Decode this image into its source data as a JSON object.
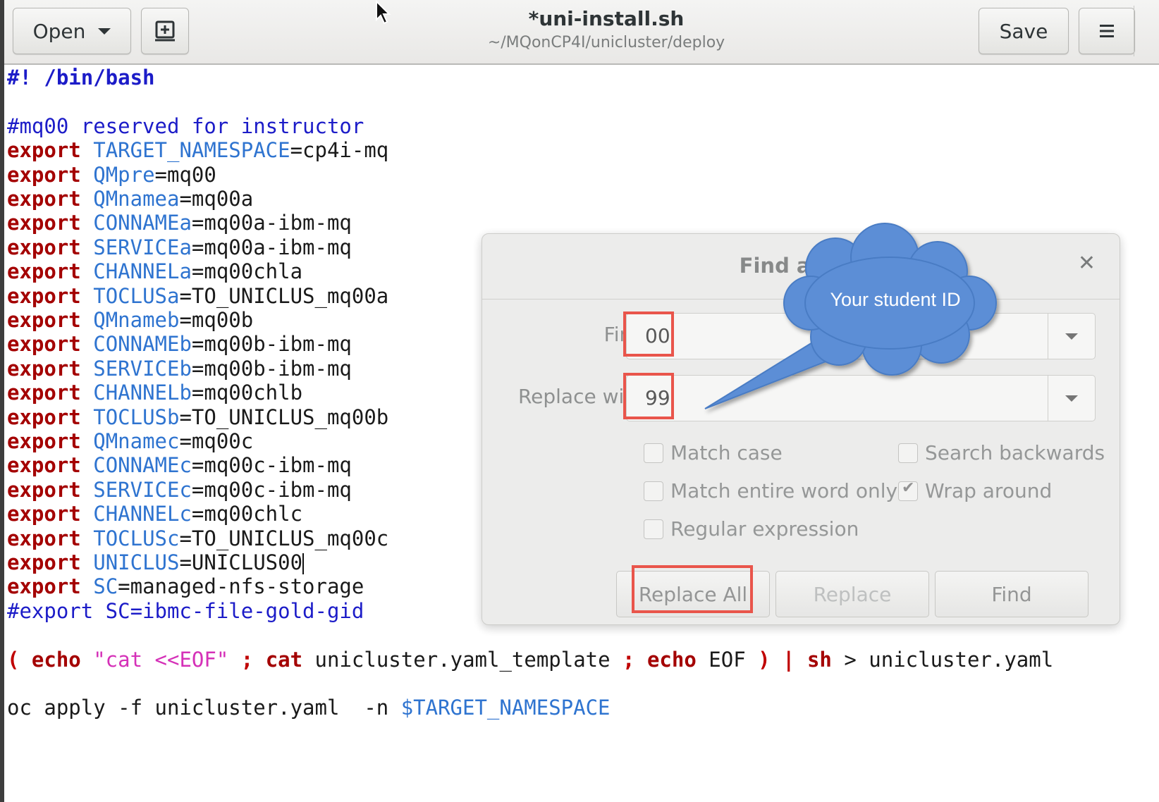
{
  "header": {
    "open_label": "Open",
    "new_doc_icon": "new-document-icon",
    "title": "*uni-install.sh",
    "path": "~/MQonCP4I/unicluster/deploy",
    "save_label": "Save",
    "menu_icon": "hamburger-menu-icon"
  },
  "editor": {
    "lines": [
      {
        "a": "#! /bin/bash"
      },
      {
        "a": ""
      },
      {
        "a": "#mq00 reserved for instructor"
      },
      {
        "kw": "export",
        "var": "TARGET_NAMESPACE",
        "val": "=cp4i-mq"
      },
      {
        "kw": "export",
        "var": "QMpre",
        "val": "=mq00"
      },
      {
        "kw": "export",
        "var": "QMnamea",
        "val": "=mq00a"
      },
      {
        "kw": "export",
        "var": "CONNAMEa",
        "val": "=mq00a-ibm-mq"
      },
      {
        "kw": "export",
        "var": "SERVICEa",
        "val": "=mq00a-ibm-mq"
      },
      {
        "kw": "export",
        "var": "CHANNELa",
        "val": "=mq00chla"
      },
      {
        "kw": "export",
        "var": "TOCLUSa",
        "val": "=TO_UNICLUS_mq00a"
      },
      {
        "kw": "export",
        "var": "QMnameb",
        "val": "=mq00b"
      },
      {
        "kw": "export",
        "var": "CONNAMEb",
        "val": "=mq00b-ibm-mq"
      },
      {
        "kw": "export",
        "var": "SERVICEb",
        "val": "=mq00b-ibm-mq"
      },
      {
        "kw": "export",
        "var": "CHANNELb",
        "val": "=mq00chlb"
      },
      {
        "kw": "export",
        "var": "TOCLUSb",
        "val": "=TO_UNICLUS_mq00b"
      },
      {
        "kw": "export",
        "var": "QMnamec",
        "val": "=mq00c"
      },
      {
        "kw": "export",
        "var": "CONNAMEc",
        "val": "=mq00c-ibm-mq"
      },
      {
        "kw": "export",
        "var": "SERVICEc",
        "val": "=mq00c-ibm-mq"
      },
      {
        "kw": "export",
        "var": "CHANNELc",
        "val": "=mq00chlc"
      },
      {
        "kw": "export",
        "var": "TOCLUSc",
        "val": "=TO_UNICLUS_mq00c"
      },
      {
        "kw": "export",
        "var": "UNICLUS",
        "val": "=UNICLUS00"
      },
      {
        "kw": "export",
        "var": "SC",
        "val": "=managed-nfs-storage"
      },
      {
        "a": "#export SC=ibmc-file-gold-gid"
      },
      {
        "a": ""
      },
      {
        "pipe": {
          "p1": "( ",
          "k1": "echo",
          "s1": " \"cat ",
          "s2": "<<EOF",
          "s3": "\"",
          "p2": " ; ",
          "k2": "cat",
          "t1": " unicluster.yaml_template ",
          "p3": "; ",
          "k3": "echo",
          "t2": " EOF ",
          "p4": ") | ",
          "k4": "sh",
          "t3": " > unicluster.yaml"
        }
      },
      {
        "a": ""
      },
      {
        "oc": {
          "cmd": "oc apply -f unicluster.yaml  -n ",
          "var": "$TARGET_NAMESPACE"
        }
      }
    ]
  },
  "dialog": {
    "title": "Find and R",
    "close_icon": "close-icon",
    "find_label": "Find",
    "find_value": "00",
    "replace_label": "Replace with",
    "replace_value": "99",
    "options": {
      "match_case": {
        "label": "Match case",
        "checked": false
      },
      "search_backwards": {
        "label": "Search backwards",
        "checked": false
      },
      "match_word": {
        "label": "Match entire word only",
        "checked": false
      },
      "wrap_around": {
        "label": "Wrap around",
        "checked": true
      },
      "regex": {
        "label": "Regular expression",
        "checked": false
      }
    },
    "buttons": {
      "replace_all": "Replace All",
      "replace": "Replace",
      "find": "Find"
    }
  },
  "callout": {
    "text": "Your student ID",
    "fill": "#5b8ed6"
  },
  "highlight_color": "#e8473c"
}
